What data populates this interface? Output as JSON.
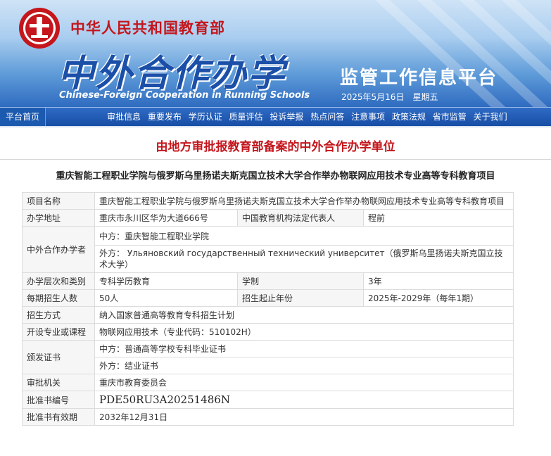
{
  "header": {
    "ministry": "中华人民共和国教育部",
    "title": "中外合作办学",
    "subtitle_en": "Chinese-Foreign Cooperation in Running Schools",
    "platform": "监管工作信息平台",
    "date": "2025年5月16日",
    "weekday": "星期五"
  },
  "nav": {
    "home": "平台首页",
    "items": [
      "审批信息",
      "重要发布",
      "学历认证",
      "质量评估",
      "投诉举报",
      "热点问答",
      "注意事项",
      "政策法规",
      "省市监管",
      "关于我们"
    ]
  },
  "section_title": "由地方审批报教育部备案的中外合作办学单位",
  "project_title": "重庆智能工程职业学院与俄罗斯乌里扬诺夫斯克国立技术大学合作举办物联网应用技术专业高等专科教育项目",
  "table": {
    "name_label": "项目名称",
    "name_value": "重庆智能工程职业学院与俄罗斯乌里扬诺夫斯克国立技术大学合作举办物联网应用技术专业高等专科教育项目",
    "address_label": "办学地址",
    "address_value": "重庆市永川区华为大道666号",
    "rep_label": "中国教育机构法定代表人",
    "rep_value": "程前",
    "partners_label": "中外合作办学者",
    "partner_cn": "中方：重庆智能工程职业学院",
    "partner_foreign": "外方： Ульяновский государственный технический университет（俄罗斯乌里扬诺夫斯克国立技术大学）",
    "level_label": "办学层次和类别",
    "level_value": "专科学历教育",
    "duration_label": "学制",
    "duration_value": "3年",
    "enroll_label": "每期招生人数",
    "enroll_value": "50人",
    "years_label": "招生起止年份",
    "years_value": "2025年-2029年（每年1期）",
    "method_label": "招生方式",
    "method_value": "纳入国家普通高等教育专科招生计划",
    "major_label": "开设专业或课程",
    "major_value": "物联网应用技术（专业代码：510102H）",
    "cert_label": "颁发证书",
    "cert_cn": "中方：普通高等学校专科毕业证书",
    "cert_foreign": "外方：结业证书",
    "authority_label": "审批机关",
    "authority_value": "重庆市教育委员会",
    "approval_no_label": "批准书编号",
    "approval_no_value": "PDE50RU3A20251486N",
    "validity_label": "批准书有效期",
    "validity_value": "2032年12月31日"
  },
  "colors": {
    "accent_red": "#c4161c",
    "brand_blue": "#1b4fa8",
    "nav_blue": "#174ea6"
  }
}
